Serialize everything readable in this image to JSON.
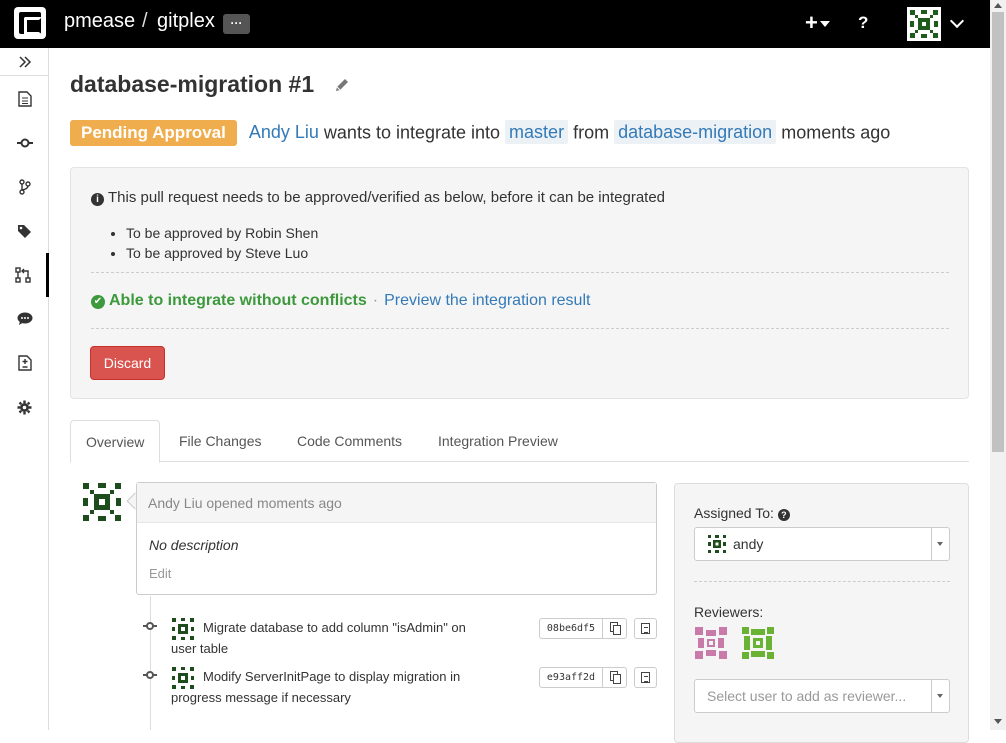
{
  "header": {
    "owner": "pmease",
    "separator": "/",
    "repo": "gitplex",
    "more_label": "···",
    "plus_label": "+",
    "help_label": "?"
  },
  "sidebar": {
    "toggle_icon": "double-chevron-right-icon",
    "items": [
      {
        "name": "files",
        "icon": "file-icon"
      },
      {
        "name": "commits",
        "icon": "commit-icon"
      },
      {
        "name": "branches",
        "icon": "branch-icon"
      },
      {
        "name": "tags",
        "icon": "tag-icon"
      },
      {
        "name": "pull-requests",
        "icon": "pull-request-icon",
        "active": true
      },
      {
        "name": "comments",
        "icon": "comment-icon"
      },
      {
        "name": "compare",
        "icon": "compare-icon"
      },
      {
        "name": "settings",
        "icon": "gear-icon"
      }
    ]
  },
  "pr": {
    "title": "database-migration #1",
    "status": "Pending Approval",
    "author": "Andy Liu",
    "text_wants": "wants to integrate into",
    "target_branch": "master",
    "text_from": "from",
    "source_branch": "database-migration",
    "time": "moments ago"
  },
  "approval": {
    "info": "This pull request needs to be approved/verified as below, before it can be integrated",
    "requirements": [
      "To be approved by Robin Shen",
      "To be approved by Steve Luo"
    ],
    "merge_status": "Able to integrate without conflicts",
    "separator": "·",
    "preview_link": "Preview the integration result",
    "discard_label": "Discard"
  },
  "tabs": [
    "Overview",
    "File Changes",
    "Code Comments",
    "Integration Preview"
  ],
  "activity": {
    "opened": "Andy Liu opened moments ago",
    "description": "No description",
    "edit": "Edit",
    "commits": [
      {
        "message": "Migrate database to add column \"isAdmin\" on user table",
        "hash": "08be6df5"
      },
      {
        "message": "Modify ServerInitPage to display migration in progress message if necessary",
        "hash": "e93aff2d"
      }
    ]
  },
  "side_panel": {
    "assigned_label": "Assigned To:",
    "assignee": "andy",
    "reviewers_label": "Reviewers:",
    "reviewer_placeholder": "Select user to add as reviewer..."
  },
  "colors": {
    "pending": "#f0ad4e",
    "success": "#3c9a3c",
    "danger": "#d9534f",
    "link": "#337ab7"
  }
}
